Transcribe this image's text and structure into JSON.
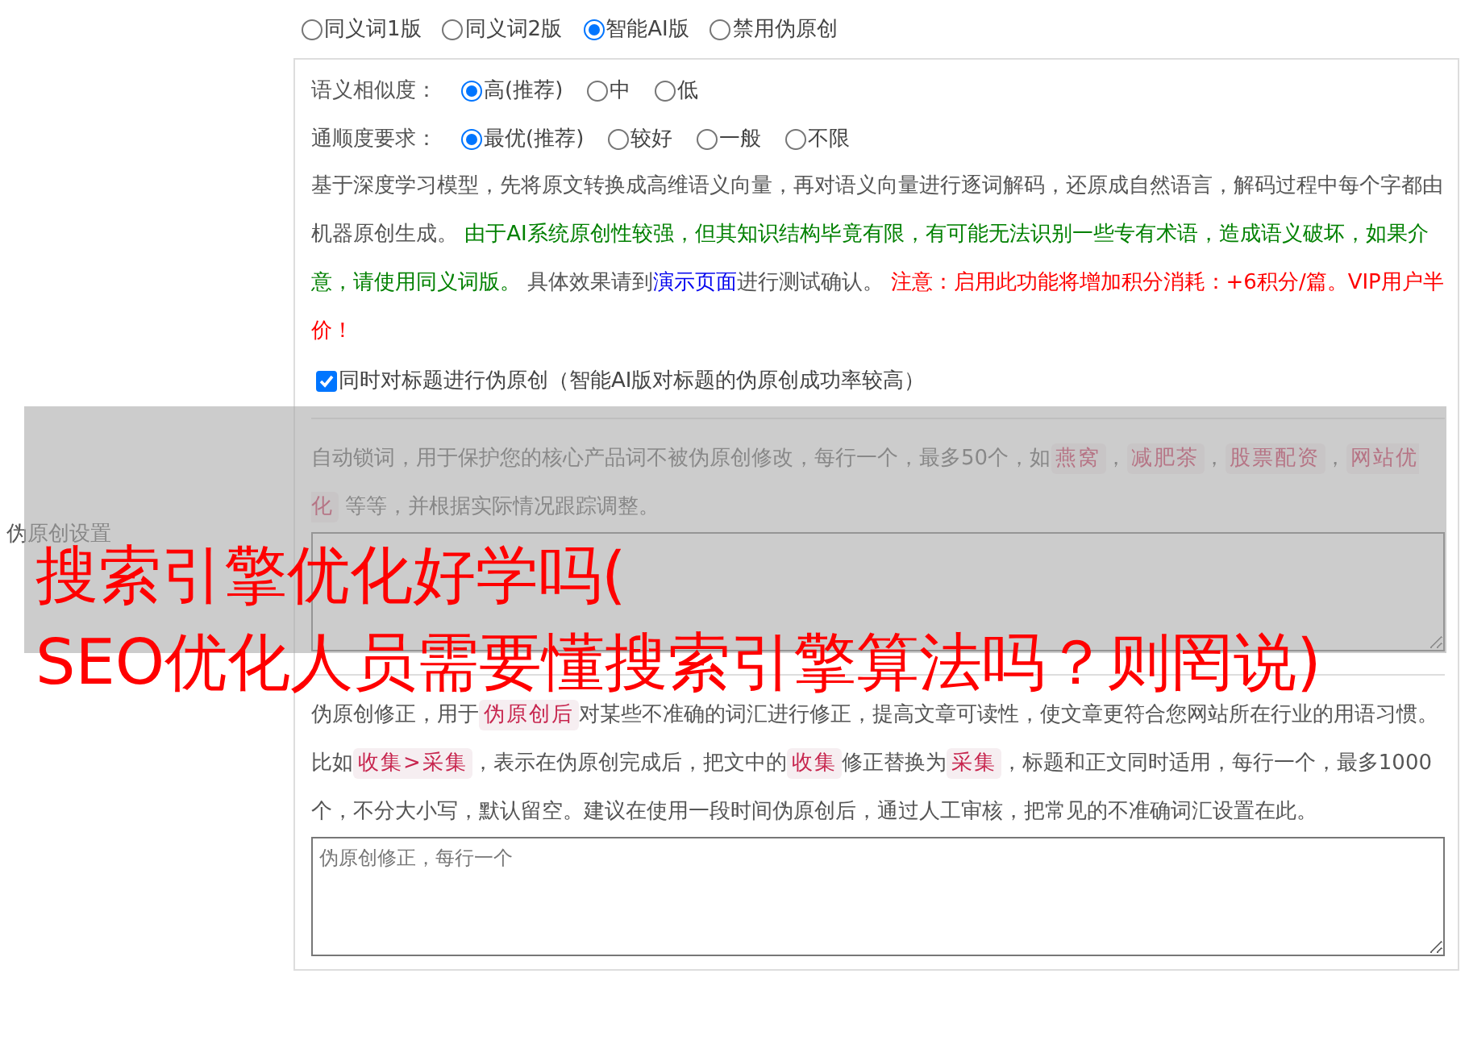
{
  "side_label": "伪原创设置",
  "modes": [
    {
      "label": "同义词1版",
      "selected": false
    },
    {
      "label": "同义词2版",
      "selected": false
    },
    {
      "label": "智能AI版",
      "selected": true
    },
    {
      "label": "禁用伪原创",
      "selected": false
    }
  ],
  "similarity": {
    "label": "语义相似度：",
    "options": [
      {
        "label": "高(推荐)",
        "selected": true
      },
      {
        "label": "中",
        "selected": false
      },
      {
        "label": "低",
        "selected": false
      }
    ]
  },
  "fluency": {
    "label": "通顺度要求：",
    "options": [
      {
        "label": "最优(推荐)",
        "selected": true
      },
      {
        "label": "较好",
        "selected": false
      },
      {
        "label": "一般",
        "selected": false
      },
      {
        "label": "不限",
        "selected": false
      }
    ]
  },
  "ai_description": [
    {
      "kind": "plain",
      "text": "基于深度学习模型，先将原文转换成高维语义向量，再对语义向量进行逐词解码，还原成自然语言，解码过程中每个字都由机器原创生成。 "
    },
    {
      "kind": "green",
      "text": "由于AI系统原创性较强，但其知识结构毕竟有限，有可能无法识别一些专有术语，造成语义破坏，如果介意，请使用同义词版。"
    },
    {
      "kind": "plain",
      "text": " 具体效果请到"
    },
    {
      "kind": "link",
      "text": "演示页面"
    },
    {
      "kind": "plain",
      "text": "进行测试确认。 "
    },
    {
      "kind": "red",
      "text": "注意：启用此功能将增加积分消耗：+6积分/篇。VIP用户半价！"
    }
  ],
  "title_option": {
    "label": "同时对标题进行伪原创（智能AI版对标题的伪原创成功率较高）",
    "checked": true
  },
  "lock_words": {
    "description": [
      {
        "kind": "plain",
        "text": "自动锁词，用于保护您的核心产品词不被伪原创修改，每行一个，最多50个，如"
      },
      {
        "kind": "code",
        "text": "燕窝"
      },
      {
        "kind": "plain",
        "text": "，"
      },
      {
        "kind": "code",
        "text": "减肥茶"
      },
      {
        "kind": "plain",
        "text": "，"
      },
      {
        "kind": "code",
        "text": "股票配资"
      },
      {
        "kind": "plain",
        "text": "，"
      },
      {
        "kind": "code",
        "text": "网站优化"
      },
      {
        "kind": "plain",
        "text": " 等等，并根据实际情况跟踪调整。"
      }
    ]
  },
  "corrections": {
    "description": [
      {
        "kind": "plain",
        "text": "伪原创修正，用于"
      },
      {
        "kind": "code",
        "text": "伪原创后"
      },
      {
        "kind": "plain",
        "text": "对某些不准确的词汇进行修正，提高文章可读性，使文章更符合您网站所在行业的用语习惯。比如"
      },
      {
        "kind": "code",
        "text": "收集>采集"
      },
      {
        "kind": "plain",
        "text": "，表示在伪原创完成后，把文中的"
      },
      {
        "kind": "code",
        "text": "收集"
      },
      {
        "kind": "plain",
        "text": "修正替换为"
      },
      {
        "kind": "code",
        "text": "采集"
      },
      {
        "kind": "plain",
        "text": "，标题和正文同时适用，每行一个，最多1000个，不分大小写，默认留空。建议在使用一段时间伪原创后，通过人工审核，把常见的不准确词汇设置在此。"
      }
    ],
    "placeholder": "伪原创修正，每行一个"
  },
  "overlay_title": {
    "line_1": "搜索引擎优化好学吗(",
    "line_2": "SEO优化人员需要懂搜索引擎算法吗？则罔说)"
  }
}
